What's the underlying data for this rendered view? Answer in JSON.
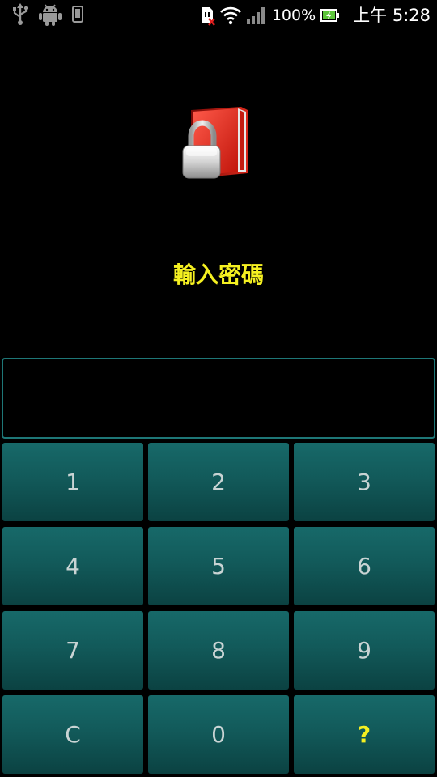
{
  "status_bar": {
    "battery_percent": "100%",
    "time": "上午 5:28",
    "icons": [
      "usb-icon",
      "android-debug-icon",
      "phone-icon",
      "sim-missing-icon",
      "wifi-icon",
      "signal-icon",
      "battery-charging-icon"
    ]
  },
  "app": {
    "icon": "lock-folder-icon",
    "prompt": "輸入密碼"
  },
  "password_field": {
    "value": ""
  },
  "keypad": {
    "keys": [
      "1",
      "2",
      "3",
      "4",
      "5",
      "6",
      "7",
      "8",
      "9",
      "C",
      "0",
      "?"
    ]
  },
  "colors": {
    "background": "#000000",
    "prompt": "#f5f021",
    "key_fill": "#125a5a",
    "field_border": "#1e7777",
    "key_text": "#c9d4d4"
  }
}
